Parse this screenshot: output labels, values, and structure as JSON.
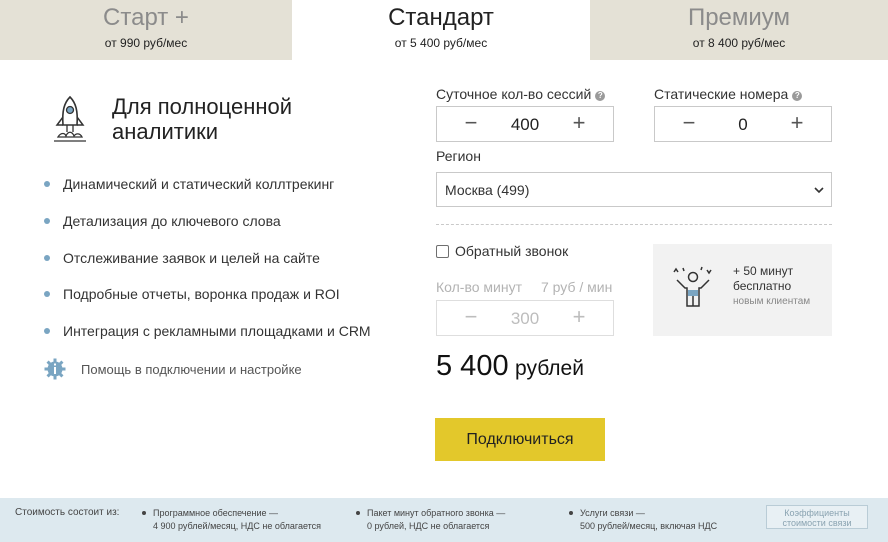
{
  "tabs": [
    {
      "name": "Старт +",
      "price": "от 990 руб/мес",
      "active": false
    },
    {
      "name": "Стандарт",
      "price": "от 5 400 руб/мес",
      "active": true
    },
    {
      "name": "Премиум",
      "price": "от 8 400 руб/мес",
      "active": false
    }
  ],
  "plan": {
    "icon": "rocket-icon",
    "title": "Для полноценной аналитики",
    "features": [
      "Динамический и статический коллтрекинг",
      "Детализация до ключевого слова",
      "Отслеживание заявок и целей на сайте",
      "Подробные отчеты, воронка продаж и ROI",
      "Интеграция с рекламными площадками и CRM"
    ],
    "help": "Помощь в подключении и настройке"
  },
  "sessions": {
    "label": "Суточное кол-во сессий",
    "help_glyph": "?",
    "value": "400",
    "minus": "−",
    "plus": "+"
  },
  "static_numbers": {
    "label": "Статические номера",
    "help_glyph": "?",
    "value": "0",
    "minus": "−",
    "plus": "+"
  },
  "region": {
    "label": "Регион",
    "value": "Москва (499)"
  },
  "callback": {
    "label": "Обратный звонок",
    "checked": false
  },
  "minutes": {
    "label": "Кол-во минут",
    "rate": "7 руб / мин",
    "value": "300",
    "minus": "−",
    "plus": "+"
  },
  "bonus": {
    "line1": "+ 50 минут",
    "line2": "бесплатно",
    "line3": "новым клиентам"
  },
  "total": {
    "amount": "5 400",
    "currency": "рублей"
  },
  "connect_label": "Подключиться",
  "footer": {
    "intro": "Стоимость состоит из:",
    "items": [
      {
        "line1": "Программное обеспечение —",
        "line2": "4 900 рублей/месяц, НДС не облагается"
      },
      {
        "line1": "Пакет минут обратного звонка —",
        "line2": "0 рублей, НДС не облагается"
      },
      {
        "line1": "Услуги связи —",
        "line2": "500 рублей/месяц, включая НДС"
      }
    ],
    "coef_line1": "Коэффициенты",
    "coef_line2": "стоимости связи"
  },
  "colors": {
    "accent_button": "#e3c82b",
    "tab_inactive": "#e4e1d6",
    "footer_bg": "#dde9ef",
    "bullet": "#7aa5c2"
  }
}
